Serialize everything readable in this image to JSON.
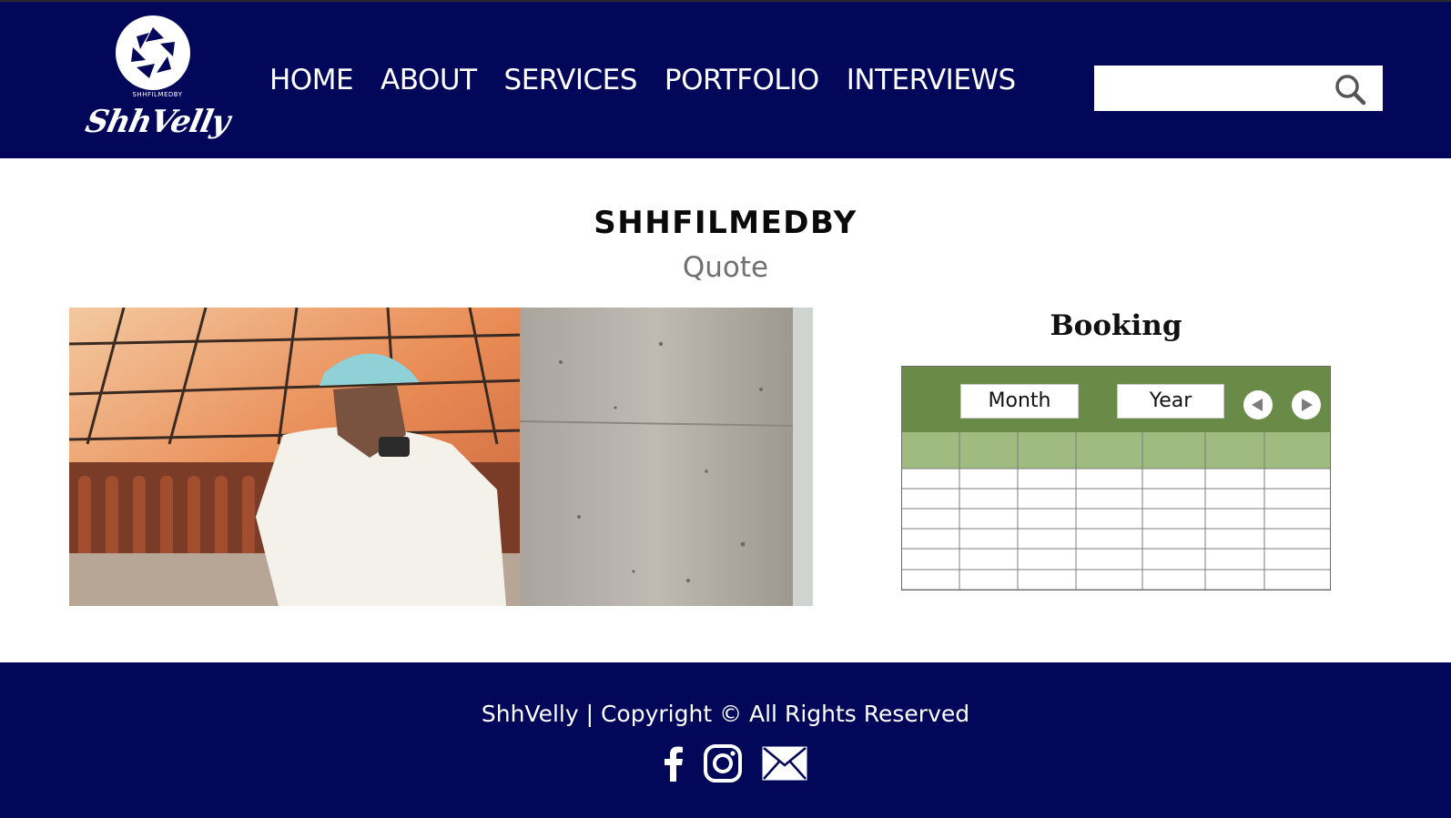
{
  "brand": {
    "logo_small_text": "SHHFILMEDBY",
    "logo_script_text": "ShhVelly"
  },
  "nav": {
    "items": [
      {
        "label": "HOME"
      },
      {
        "label": "ABOUT"
      },
      {
        "label": "SERVICES"
      },
      {
        "label": "PORTFOLIO"
      },
      {
        "label": "INTERVIEWS"
      }
    ]
  },
  "search": {
    "value": "",
    "icon": "search-icon"
  },
  "main": {
    "title": "SHHFILMEDBY",
    "subtitle": "Quote"
  },
  "booking": {
    "title": "Booking",
    "month_label": "Month",
    "year_label": "Year",
    "prev_icon": "triangle-left-icon",
    "next_icon": "triangle-right-icon"
  },
  "footer": {
    "copyright": "ShhVelly | Copyright © All Rights Reserved",
    "social": [
      "facebook-icon",
      "instagram-icon",
      "email-icon"
    ]
  },
  "colors": {
    "header_bg": "#02075a",
    "footer_bg": "#02075a",
    "calendar_header": "#6a8a47",
    "calendar_days": "#9fbb7f",
    "subtitle_text": "#707070"
  }
}
